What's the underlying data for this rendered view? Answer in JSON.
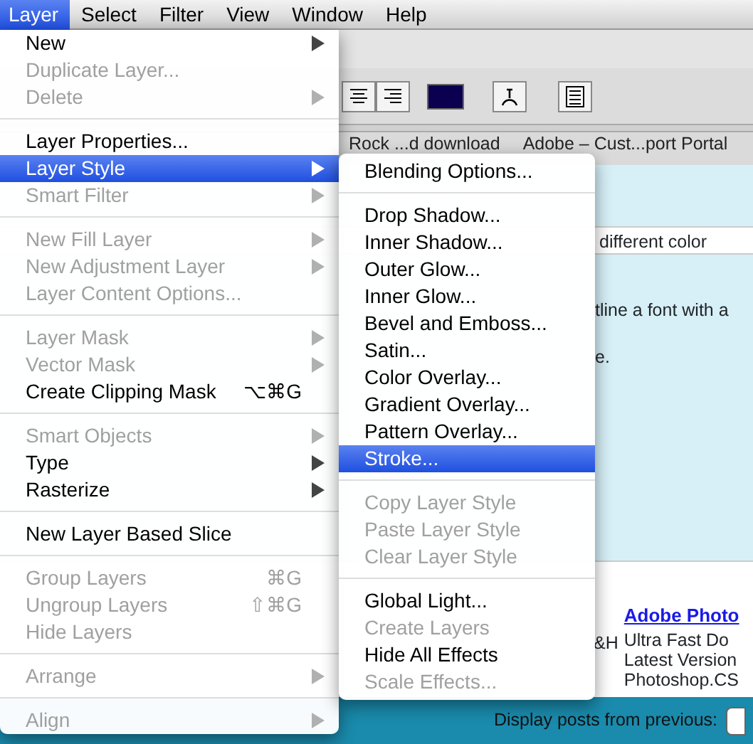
{
  "menubar": [
    {
      "label": "Layer",
      "selected": true
    },
    {
      "label": "Select",
      "selected": false
    },
    {
      "label": "Filter",
      "selected": false
    },
    {
      "label": "View",
      "selected": false
    },
    {
      "label": "Window",
      "selected": false
    },
    {
      "label": "Help",
      "selected": false
    }
  ],
  "toolbar": {
    "swatch": {
      "color": "#0b0050"
    }
  },
  "bookmarks": [
    "Rock ...d download",
    "Adobe – Cust...port Portal"
  ],
  "page": {
    "row_text": "different color",
    "lines": [
      "tline a font with a",
      "e."
    ],
    "fragment": "&H",
    "ad": {
      "title": "Adobe Photo",
      "lines": [
        "Ultra Fast Do",
        "Latest Version",
        "Photoshop.CS"
      ]
    },
    "footer_label": "Display posts from previous:"
  },
  "layer_menu": [
    {
      "kind": "item",
      "label": "New",
      "disabled": false,
      "selected": false,
      "submenu": true
    },
    {
      "kind": "item",
      "label": "Duplicate Layer...",
      "disabled": true,
      "selected": false,
      "submenu": false
    },
    {
      "kind": "item",
      "label": "Delete",
      "disabled": true,
      "selected": false,
      "submenu": true
    },
    {
      "kind": "separator"
    },
    {
      "kind": "item",
      "label": "Layer Properties...",
      "disabled": false,
      "selected": false,
      "submenu": false
    },
    {
      "kind": "item",
      "label": "Layer Style",
      "disabled": false,
      "selected": true,
      "submenu": true
    },
    {
      "kind": "item",
      "label": "Smart Filter",
      "disabled": true,
      "selected": false,
      "submenu": true
    },
    {
      "kind": "separator"
    },
    {
      "kind": "item",
      "label": "New Fill Layer",
      "disabled": true,
      "selected": false,
      "submenu": true
    },
    {
      "kind": "item",
      "label": "New Adjustment Layer",
      "disabled": true,
      "selected": false,
      "submenu": true
    },
    {
      "kind": "item",
      "label": "Layer Content Options...",
      "disabled": true,
      "selected": false,
      "submenu": false
    },
    {
      "kind": "separator"
    },
    {
      "kind": "item",
      "label": "Layer Mask",
      "disabled": true,
      "selected": false,
      "submenu": true
    },
    {
      "kind": "item",
      "label": "Vector Mask",
      "disabled": true,
      "selected": false,
      "submenu": true
    },
    {
      "kind": "item",
      "label": "Create Clipping Mask",
      "shortcut": "⌥⌘G",
      "disabled": false,
      "selected": false,
      "submenu": false
    },
    {
      "kind": "separator"
    },
    {
      "kind": "item",
      "label": "Smart Objects",
      "disabled": true,
      "selected": false,
      "submenu": true
    },
    {
      "kind": "item",
      "label": "Type",
      "disabled": false,
      "selected": false,
      "submenu": true
    },
    {
      "kind": "item",
      "label": "Rasterize",
      "disabled": false,
      "selected": false,
      "submenu": true
    },
    {
      "kind": "separator"
    },
    {
      "kind": "item",
      "label": "New Layer Based Slice",
      "disabled": false,
      "selected": false,
      "submenu": false
    },
    {
      "kind": "separator"
    },
    {
      "kind": "item",
      "label": "Group Layers",
      "shortcut": "⌘G",
      "disabled": true,
      "selected": false,
      "submenu": false
    },
    {
      "kind": "item",
      "label": "Ungroup Layers",
      "shortcut": "⇧⌘G",
      "disabled": true,
      "selected": false,
      "submenu": false
    },
    {
      "kind": "item",
      "label": "Hide Layers",
      "disabled": true,
      "selected": false,
      "submenu": false
    },
    {
      "kind": "separator"
    },
    {
      "kind": "item",
      "label": "Arrange",
      "disabled": true,
      "selected": false,
      "submenu": true
    },
    {
      "kind": "separator"
    },
    {
      "kind": "item",
      "label": "Align",
      "disabled": true,
      "selected": false,
      "submenu": true
    }
  ],
  "style_submenu": [
    {
      "kind": "item",
      "label": "Blending Options...",
      "disabled": false,
      "selected": false
    },
    {
      "kind": "separator"
    },
    {
      "kind": "item",
      "label": "Drop Shadow...",
      "disabled": false,
      "selected": false
    },
    {
      "kind": "item",
      "label": "Inner Shadow...",
      "disabled": false,
      "selected": false
    },
    {
      "kind": "item",
      "label": "Outer Glow...",
      "disabled": false,
      "selected": false
    },
    {
      "kind": "item",
      "label": "Inner Glow...",
      "disabled": false,
      "selected": false
    },
    {
      "kind": "item",
      "label": "Bevel and Emboss...",
      "disabled": false,
      "selected": false
    },
    {
      "kind": "item",
      "label": "Satin...",
      "disabled": false,
      "selected": false
    },
    {
      "kind": "item",
      "label": "Color Overlay...",
      "disabled": false,
      "selected": false
    },
    {
      "kind": "item",
      "label": "Gradient Overlay...",
      "disabled": false,
      "selected": false
    },
    {
      "kind": "item",
      "label": "Pattern Overlay...",
      "disabled": false,
      "selected": false
    },
    {
      "kind": "item",
      "label": "Stroke...",
      "disabled": false,
      "selected": true
    },
    {
      "kind": "separator"
    },
    {
      "kind": "item",
      "label": "Copy Layer Style",
      "disabled": true,
      "selected": false
    },
    {
      "kind": "item",
      "label": "Paste Layer Style",
      "disabled": true,
      "selected": false
    },
    {
      "kind": "item",
      "label": "Clear Layer Style",
      "disabled": true,
      "selected": false
    },
    {
      "kind": "separator"
    },
    {
      "kind": "item",
      "label": "Global Light...",
      "disabled": false,
      "selected": false
    },
    {
      "kind": "item",
      "label": "Create Layers",
      "disabled": true,
      "selected": false
    },
    {
      "kind": "item",
      "label": "Hide All Effects",
      "disabled": false,
      "selected": false
    },
    {
      "kind": "item",
      "label": "Scale Effects...",
      "disabled": true,
      "selected": false
    }
  ]
}
